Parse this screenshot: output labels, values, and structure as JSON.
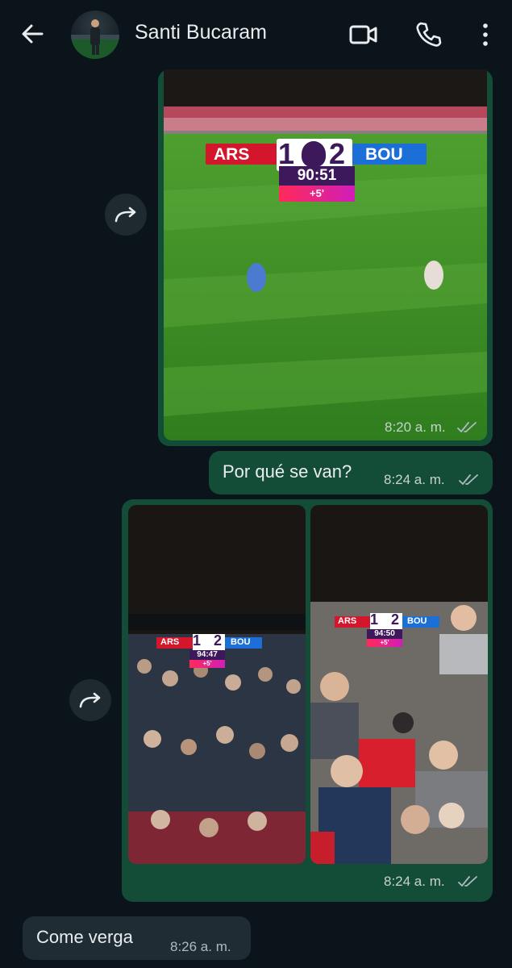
{
  "header": {
    "contact_name": "Santi Bucaram",
    "icons": [
      "back-arrow-icon",
      "video-call-icon",
      "phone-icon",
      "more-vert-icon"
    ]
  },
  "messages": [
    {
      "type": "image",
      "direction": "outgoing",
      "scoreboard": {
        "home": "ARS",
        "home_score": "1",
        "away_score": "2",
        "away": "BOU",
        "clock": "90:51",
        "added": "+5'"
      },
      "time": "8:20 a. m.",
      "status": "read"
    },
    {
      "type": "text",
      "direction": "outgoing",
      "text": "Por qué se van?",
      "time": "8:24 a. m.",
      "status": "read"
    },
    {
      "type": "image-album",
      "direction": "outgoing",
      "images": [
        {
          "scoreboard": {
            "home": "ARS",
            "home_score": "1",
            "away_score": "2",
            "away": "BOU",
            "clock": "94:47",
            "added": "+5'"
          }
        },
        {
          "scoreboard": {
            "home": "ARS",
            "home_score": "1",
            "away_score": "2",
            "away": "BOU",
            "clock": "94:50",
            "added": "+5'"
          }
        }
      ],
      "time": "8:24 a. m.",
      "status": "read"
    },
    {
      "type": "text",
      "direction": "incoming",
      "text": "Come verga",
      "time": "8:26 a. m."
    }
  ],
  "colors": {
    "background": "#0b141a",
    "outgoing_bubble": "#144d37",
    "incoming_bubble": "#202c33",
    "read_ticks": "#aebac1"
  }
}
